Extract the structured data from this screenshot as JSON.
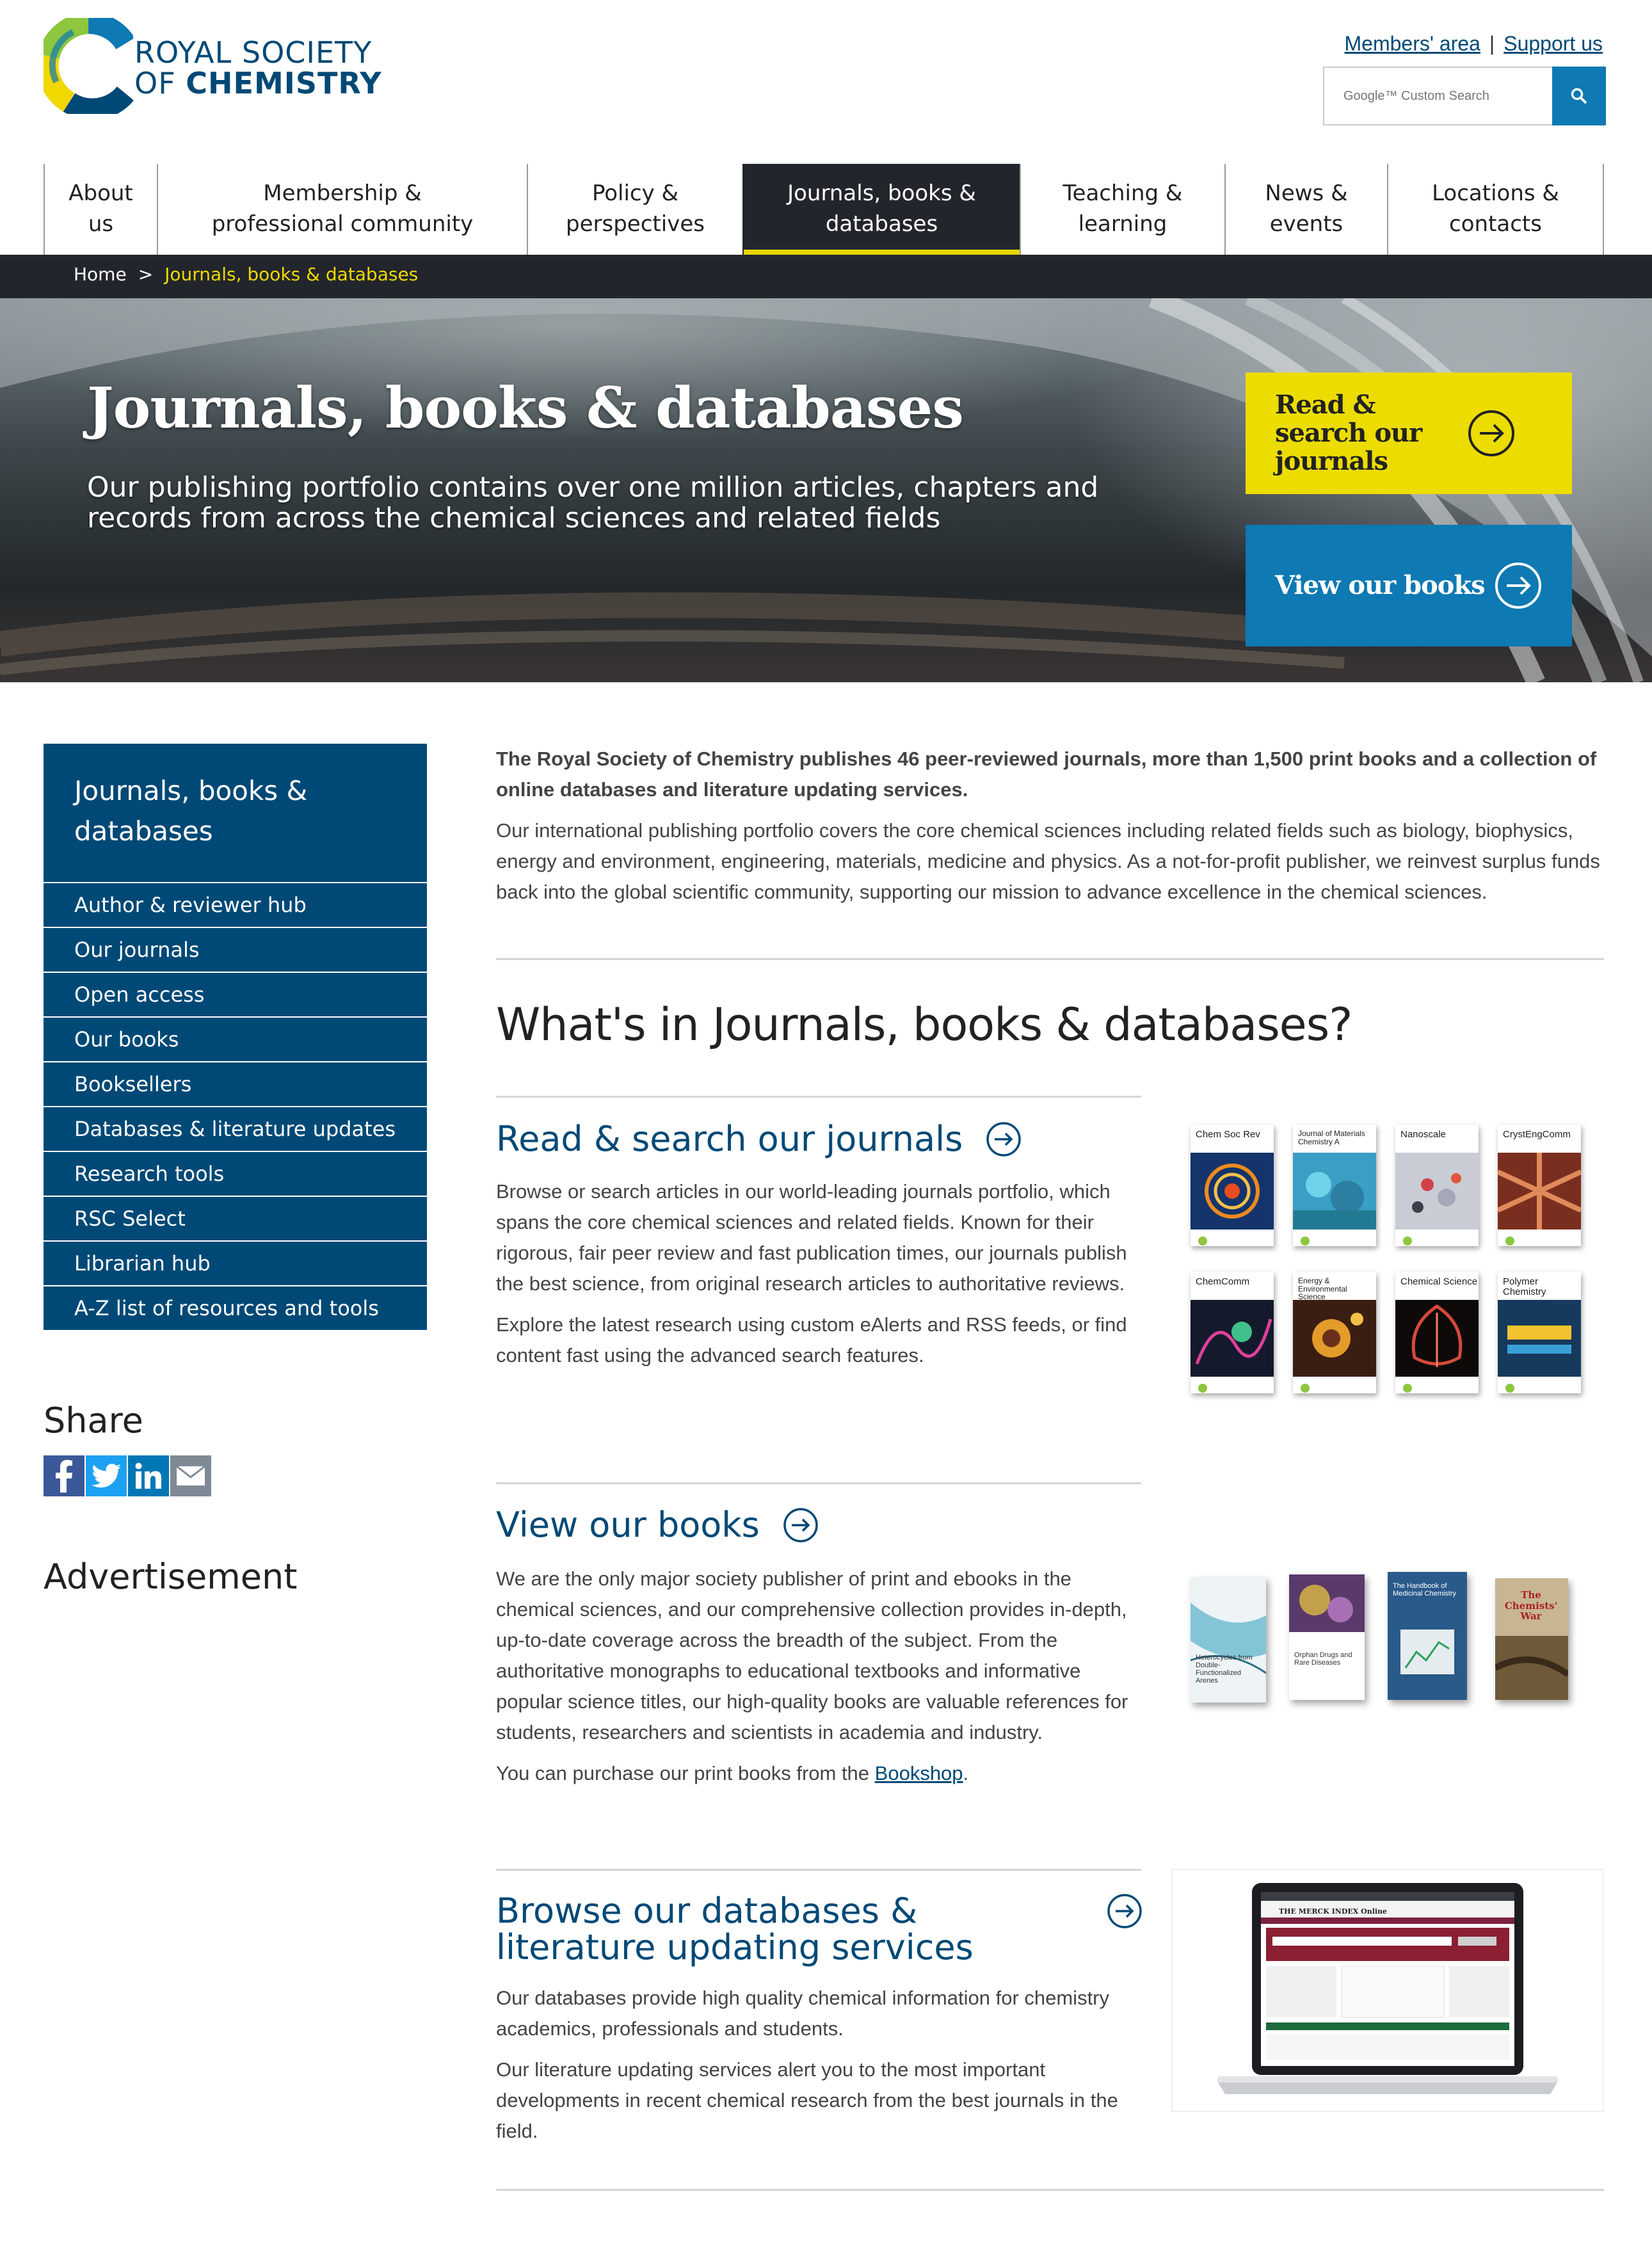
{
  "brand": {
    "line1": "ROYAL SOCIETY",
    "line2_prefix": "OF ",
    "line2_bold": "CHEMISTRY"
  },
  "colors": {
    "navy": "#004976",
    "blue": "#0e79b2",
    "yellow": "#ecdc00",
    "dark": "#22262c"
  },
  "header": {
    "members_link": "Members' area",
    "separator": "|",
    "support_link": "Support us",
    "search_placeholder": "Google™ Custom Search",
    "search_icon": "search-icon"
  },
  "nav": {
    "items": [
      {
        "label": "About us"
      },
      {
        "label": "Membership & professional community"
      },
      {
        "label": "Policy & perspectives"
      },
      {
        "label": "Journals, books & databases",
        "active": true
      },
      {
        "label": "Teaching & learning"
      },
      {
        "label": "News & events"
      },
      {
        "label": "Locations & contacts"
      }
    ]
  },
  "breadcrumb": {
    "home": "Home",
    "separator": ">",
    "current": "Journals, books & databases"
  },
  "hero": {
    "title": "Journals, books & databases",
    "subtitle": "Our publishing portfolio contains over one million articles, chapters and records from across the chemical sciences and related fields",
    "cta_journals": "Read & search our journals",
    "cta_books": "View our books"
  },
  "sidebar": {
    "heading": "Journals, books & databases",
    "items": [
      {
        "label": "Author & reviewer hub"
      },
      {
        "label": "Our journals"
      },
      {
        "label": "Open access"
      },
      {
        "label": "Our books"
      },
      {
        "label": "Booksellers"
      },
      {
        "label": "Databases & literature updates"
      },
      {
        "label": "Research tools"
      },
      {
        "label": "RSC Select"
      },
      {
        "label": "Librarian hub"
      },
      {
        "label": "A-Z list of resources and tools"
      }
    ],
    "share_title": "Share",
    "share_icons": [
      "facebook-icon",
      "twitter-icon",
      "linkedin-icon",
      "email-icon"
    ],
    "advert_title": "Advertisement"
  },
  "main": {
    "intro_bold": "The Royal Society of Chemistry publishes 46 peer-reviewed journals, more than 1,500 print books and a collection of online databases and literature updating services.",
    "intro_body": "Our international publishing portfolio covers the core chemical sciences including related fields such as biology, biophysics, energy and environment, engineering, materials, medicine and physics. As a not-for-profit publisher, we reinvest surplus funds back into the global scientific community, supporting our mission to advance excellence in the chemical sciences.",
    "heading": "What's in Journals, books & databases?",
    "journals": {
      "title": "Read & search our journals",
      "p1": "Browse or search articles in our world-leading journals portfolio, which spans the core chemical sciences and related fields. Known for their rigorous, fair peer review and fast publication times, our journals publish the best science, from original research articles to authoritative reviews.",
      "p2": "Explore the latest research using custom eAlerts and RSS feeds, or find content fast using the advanced search features.",
      "covers": [
        {
          "name": "Chem Soc Rev"
        },
        {
          "name": "Journal of Materials Chemistry A"
        },
        {
          "name": "Nanoscale"
        },
        {
          "name": "CrystEngComm"
        },
        {
          "name": "ChemComm"
        },
        {
          "name": "Energy & Environmental Science"
        },
        {
          "name": "Chemical Science"
        },
        {
          "name": "Polymer Chemistry"
        }
      ]
    },
    "books": {
      "title": "View our books",
      "p1": "We are the only major society publisher of print and ebooks in the chemical sciences, and our comprehensive collection provides in-depth, up-to-date coverage across the breadth of the subject. From the authoritative monographs to educational textbooks and informative popular science titles, our high-quality books are valuable references for students, researchers and scientists in academia and industry.",
      "p2_prefix": "You can purchase our print books from the ",
      "p2_link": "Bookshop",
      "p2_suffix": ".",
      "book_titles": [
        "Heterocycles from Double-Functionalized Arenes",
        "Orphan Drugs and Rare Diseases",
        "The Handbook of Medicinal Chemistry",
        "The Chemists' War"
      ]
    },
    "databases": {
      "title": "Browse our databases & literature updating services",
      "p1": "Our databases provide high quality chemical information for chemistry academics, professionals and students.",
      "p2": "Our literature updating services alert you to the most important developments in recent chemical research from the best journals in the field.",
      "screen_title": "THE MERCK INDEX Online"
    }
  }
}
